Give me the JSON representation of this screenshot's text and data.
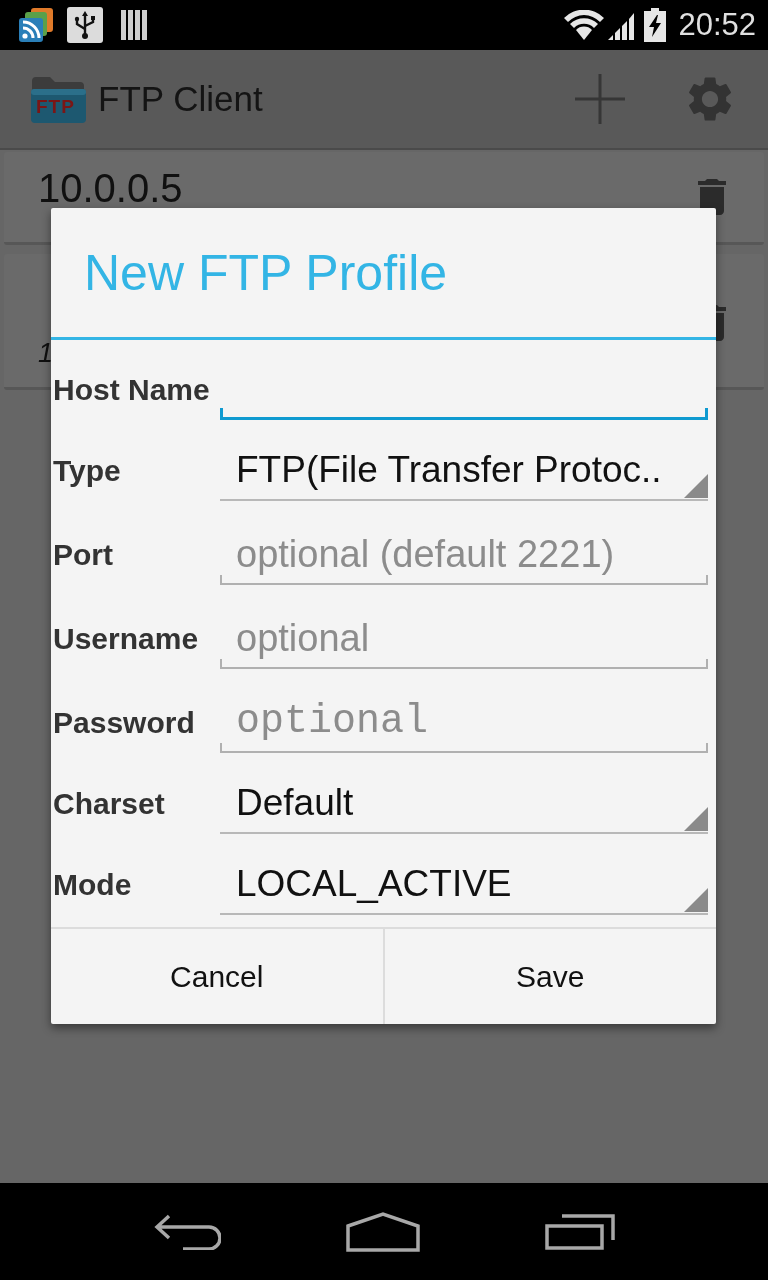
{
  "status_bar": {
    "time": "20:52"
  },
  "action_bar": {
    "logo_text": "FTP",
    "title": "FTP Client"
  },
  "profiles": [
    {
      "name": "10.0.0.5"
    },
    {
      "subtitle": "1"
    }
  ],
  "dialog": {
    "title": "New FTP Profile",
    "fields": [
      {
        "label": "Host Name",
        "kind": "text",
        "focused": true
      },
      {
        "label": "Type",
        "kind": "dropdown",
        "value": "FTP(File Transfer Protoc..",
        "focused": false
      },
      {
        "label": "Port",
        "kind": "text",
        "placeholder": "optional (default 2221)",
        "focused": false
      },
      {
        "label": "Username",
        "kind": "text",
        "placeholder": "optional",
        "focused": false
      },
      {
        "label": "Password",
        "kind": "password",
        "placeholder": "optional",
        "focused": false
      },
      {
        "label": "Charset",
        "kind": "dropdown",
        "value": "Default",
        "focused": false
      },
      {
        "label": "Mode",
        "kind": "dropdown",
        "value": "LOCAL_ACTIVE",
        "focused": false
      }
    ],
    "buttons": [
      {
        "label": "Cancel"
      },
      {
        "label": "Save"
      }
    ]
  }
}
